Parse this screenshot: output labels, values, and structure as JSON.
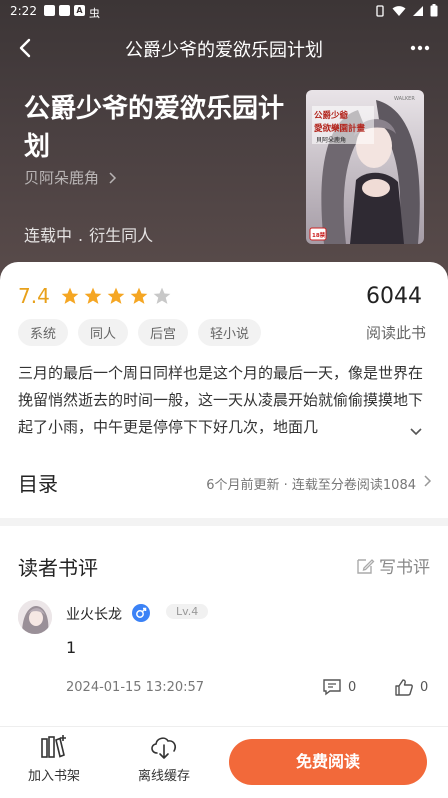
{
  "status_bar": {
    "time": "2:22",
    "notif_icons": [
      "",
      "",
      "A",
      "虫"
    ]
  },
  "nav": {
    "title": "公爵少爷的爱欲乐园计划"
  },
  "book": {
    "title": "公爵少爷的爱欲乐园计划",
    "author": "贝阿朵鹿角",
    "status": "连载中",
    "separator": ".",
    "category": "衍生同人",
    "cover_title": "公爵少爺的愛欲樂園計畫",
    "cover_author": "貝阿朵鹿角",
    "cover_brand": "WALKER",
    "cover_badge": "18禁"
  },
  "rating": {
    "score": "7.4",
    "stars_full": 4,
    "stars_total": 5
  },
  "readers": {
    "count": "6044",
    "label": "阅读此书"
  },
  "tags": [
    "系统",
    "同人",
    "后宫",
    "轻小说"
  ],
  "intro": "三月的最后一个周日同样也是这个月的最后一天，像是世界在挽留悄然逝去的时间一般，这一天从凌晨开始就偷偷摸摸地下起了小雨，中午更是停停下下好几次，地面几",
  "toc": {
    "title": "目录",
    "info": "6个月前更新 · 连载至分卷阅读1084"
  },
  "reviews": {
    "title": "读者书评",
    "write_label": "写书评",
    "items": [
      {
        "user": "业火长龙",
        "level": "Lv.4",
        "text": "1",
        "date": "2024-01-15 13:20:57",
        "comments": "0",
        "likes": "0"
      }
    ]
  },
  "bottom_bar": {
    "shelf_label": "加入书架",
    "offline_label": "离线缓存",
    "read_label": "免费阅读"
  },
  "colors": {
    "accent": "#f2693a",
    "star": "#f5a623",
    "score": "#e8a11b",
    "gender": "#3b82f6"
  }
}
